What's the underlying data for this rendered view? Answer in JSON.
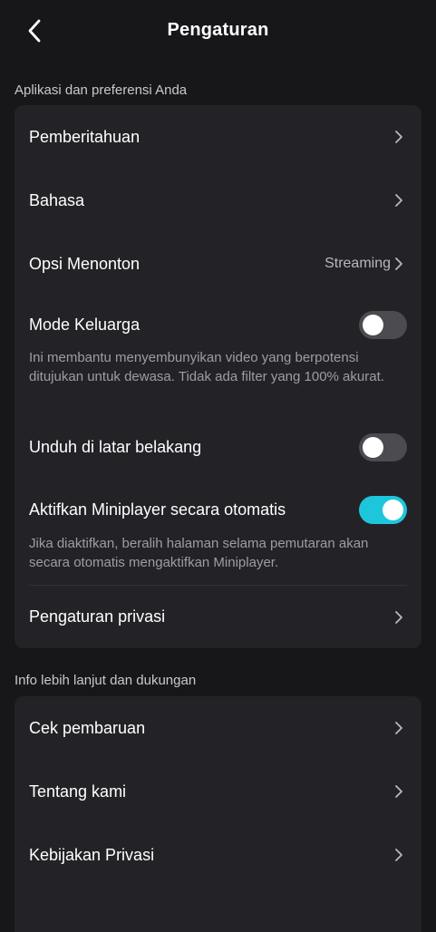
{
  "header": {
    "title": "Pengaturan"
  },
  "sections": {
    "app_prefs": {
      "label": "Aplikasi dan preferensi Anda",
      "items": {
        "notifications": {
          "label": "Pemberitahuan"
        },
        "language": {
          "label": "Bahasa"
        },
        "watch_options": {
          "label": "Opsi Menonton",
          "value": "Streaming"
        },
        "family_mode": {
          "label": "Mode Keluarga",
          "enabled": false,
          "description": "Ini membantu menyembunyikan video yang berpotensi ditujukan untuk dewasa. Tidak ada filter yang 100% akurat."
        },
        "background_download": {
          "label": "Unduh di latar belakang",
          "enabled": false
        },
        "auto_miniplayer": {
          "label": "Aktifkan Miniplayer secara otomatis",
          "enabled": true,
          "description": "Jika diaktifkan, beralih halaman selama pemutaran akan secara otomatis mengaktifkan Miniplayer."
        },
        "privacy_settings": {
          "label": "Pengaturan privasi"
        }
      }
    },
    "info_support": {
      "label": "Info lebih lanjut dan dukungan",
      "items": {
        "check_update": {
          "label": "Cek pembaruan"
        },
        "about_us": {
          "label": "Tentang kami"
        },
        "privacy_policy": {
          "label": "Kebijakan Privasi"
        }
      }
    }
  },
  "colors": {
    "background": "#17171a",
    "card": "#232327",
    "toggle_on": "#1ec6dc",
    "toggle_off": "#4b4b50"
  }
}
